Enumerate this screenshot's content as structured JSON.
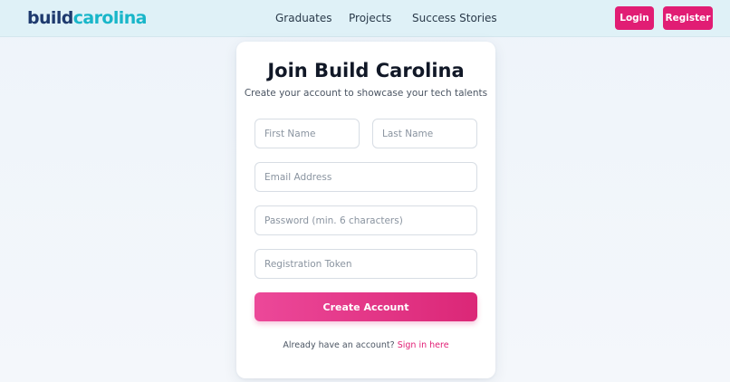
{
  "logo": {
    "part1": "build",
    "part2": "carolina"
  },
  "nav": {
    "items": [
      {
        "label": "Graduates"
      },
      {
        "label": "Projects"
      },
      {
        "label": "Success Stories"
      }
    ]
  },
  "auth": {
    "login_label": "Login",
    "register_label": "Register"
  },
  "form": {
    "title": "Join Build Carolina",
    "subtitle": "Create your account to showcase your tech talents",
    "first_name_placeholder": "First Name",
    "last_name_placeholder": "Last Name",
    "email_placeholder": "Email Address",
    "password_placeholder": "Password (min. 6 characters)",
    "token_placeholder": "Registration Token",
    "submit_label": "Create Account",
    "signin_prompt": "Already have an account?",
    "signin_link": "Sign in here"
  },
  "colors": {
    "accent": "#e11d74",
    "header_bg": "#dff1f7",
    "logo_dark": "#1e3a6e",
    "logo_light": "#19b6c9"
  }
}
